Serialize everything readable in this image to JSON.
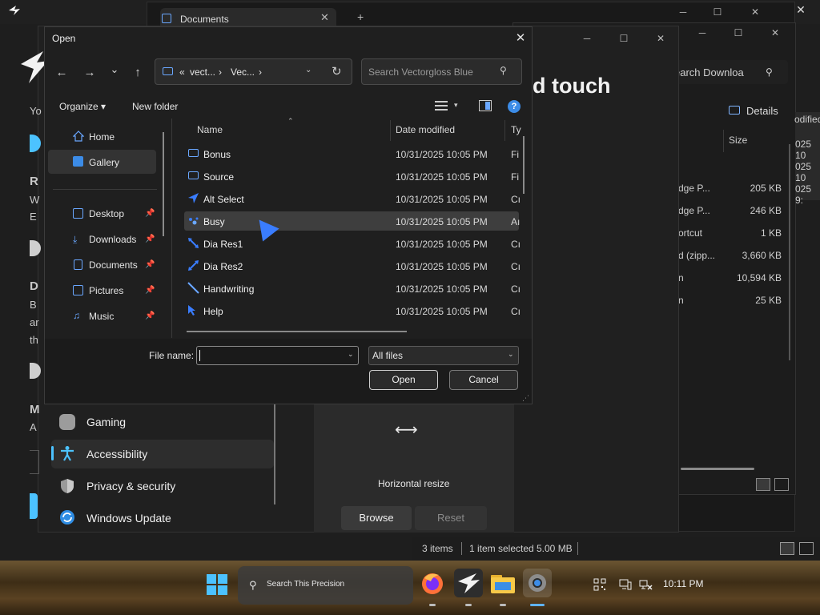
{
  "explorer": {
    "tab_label": "Documents",
    "tab_close": "✕",
    "tab_add": "+",
    "minimize": "─",
    "maximize": "☐",
    "close": "✕"
  },
  "downloads": {
    "search_text": "earch Downloa",
    "search_icon": "⚲",
    "details_label": "Details",
    "size_header": "Size",
    "modified_fragment": "odified",
    "date_fragments": [
      "025 10",
      "025 10",
      "025 9:"
    ],
    "minimize": "─",
    "maximize": "☐",
    "close": "✕",
    "rows": [
      {
        "name": "dge P...",
        "size": "205 KB"
      },
      {
        "name": "dge P...",
        "size": "246 KB"
      },
      {
        "name": "ortcut",
        "size": "1 KB"
      },
      {
        "name": "d (zipp...",
        "size": "3,660 KB"
      },
      {
        "name": "n",
        "size": "10,594 KB"
      },
      {
        "name": "n",
        "size": "25 KB"
      }
    ],
    "status": {
      "items": "3 items",
      "selected": "1 item selected",
      "size": "5.00 MB"
    }
  },
  "settings": {
    "heading_fragment": "d touch",
    "left_fragments": [
      "Yo",
      "R",
      "W",
      "E",
      "D",
      "B",
      "ar",
      "th",
      "M",
      "A"
    ],
    "nav": [
      {
        "label": "Gaming",
        "selected": false
      },
      {
        "label": "Accessibility",
        "selected": true
      },
      {
        "label": "Privacy & security",
        "selected": false
      },
      {
        "label": "Windows Update",
        "selected": false
      }
    ],
    "resize_icon": "⟷",
    "resize_label": "Horizontal resize",
    "browse_label": "Browse",
    "reset_label": "Reset",
    "minimize": "─",
    "maximize": "☐",
    "close": "✕"
  },
  "dialog": {
    "title": "Open",
    "close": "✕",
    "nav_back": "←",
    "nav_forward": "→",
    "nav_recent": "⌄",
    "nav_up": "↑",
    "address": {
      "prefix": "«",
      "seg1": "vect...",
      "sep": "›",
      "seg2": "Vec...",
      "drop": "⌄",
      "refresh": "↻"
    },
    "search_placeholder": "Search Vectorgloss Blue",
    "search_icon": "⚲",
    "toolbar": {
      "organize": "Organize ▾",
      "new_folder": "New folder",
      "view_caret": "▾",
      "help": "?"
    },
    "nav_pane": [
      {
        "label": "Home",
        "pinned": false
      },
      {
        "label": "Gallery",
        "pinned": false
      },
      {
        "label": "Desktop",
        "pinned": true
      },
      {
        "label": "Downloads",
        "pinned": true
      },
      {
        "label": "Documents",
        "pinned": true
      },
      {
        "label": "Pictures",
        "pinned": true
      },
      {
        "label": "Music",
        "pinned": true
      }
    ],
    "columns": {
      "name": "Name",
      "date": "Date modified",
      "type": "Ty"
    },
    "sort_glyph": "⌃",
    "pin_glyph": "📌",
    "rows": [
      {
        "name": "Bonus",
        "date": "10/31/2025 10:05 PM",
        "type": "Fi",
        "kind": "folder"
      },
      {
        "name": "Source",
        "date": "10/31/2025 10:05 PM",
        "type": "Fi",
        "kind": "folder"
      },
      {
        "name": "Alt Select",
        "date": "10/31/2025 10:05 PM",
        "type": "Cı",
        "kind": "cursor"
      },
      {
        "name": "Busy",
        "date": "10/31/2025 10:05 PM",
        "type": "Aı",
        "kind": "cursor"
      },
      {
        "name": "Dia Res1",
        "date": "10/31/2025 10:05 PM",
        "type": "Cı",
        "kind": "cursor"
      },
      {
        "name": "Dia Res2",
        "date": "10/31/2025 10:05 PM",
        "type": "Cı",
        "kind": "cursor"
      },
      {
        "name": "Handwriting",
        "date": "10/31/2025 10:05 PM",
        "type": "Cı",
        "kind": "cursor"
      },
      {
        "name": "Help",
        "date": "10/31/2025 10:05 PM",
        "type": "Cı",
        "kind": "cursor"
      }
    ],
    "selected_row": "Busy",
    "file_name_label": "File name:",
    "file_name_value": "",
    "file_name_drop": "⌄",
    "filter_value": "All files",
    "filter_drop": "⌄",
    "open_label": "Open",
    "cancel_label": "Cancel",
    "grip": "⋰"
  },
  "taskbar": {
    "search_placeholder": "Search This Precision",
    "search_icon": "⚲",
    "tray_icons": [
      "qr-icon",
      "phone-link-icon",
      "network-muted-icon"
    ],
    "clock": "10:11 PM"
  },
  "colors": {
    "accent": "#4cc2ff",
    "folder_blue": "#6aa7ff",
    "cursor_blue": "#3a7dff",
    "taskbar_active": "#5fb3ff"
  }
}
